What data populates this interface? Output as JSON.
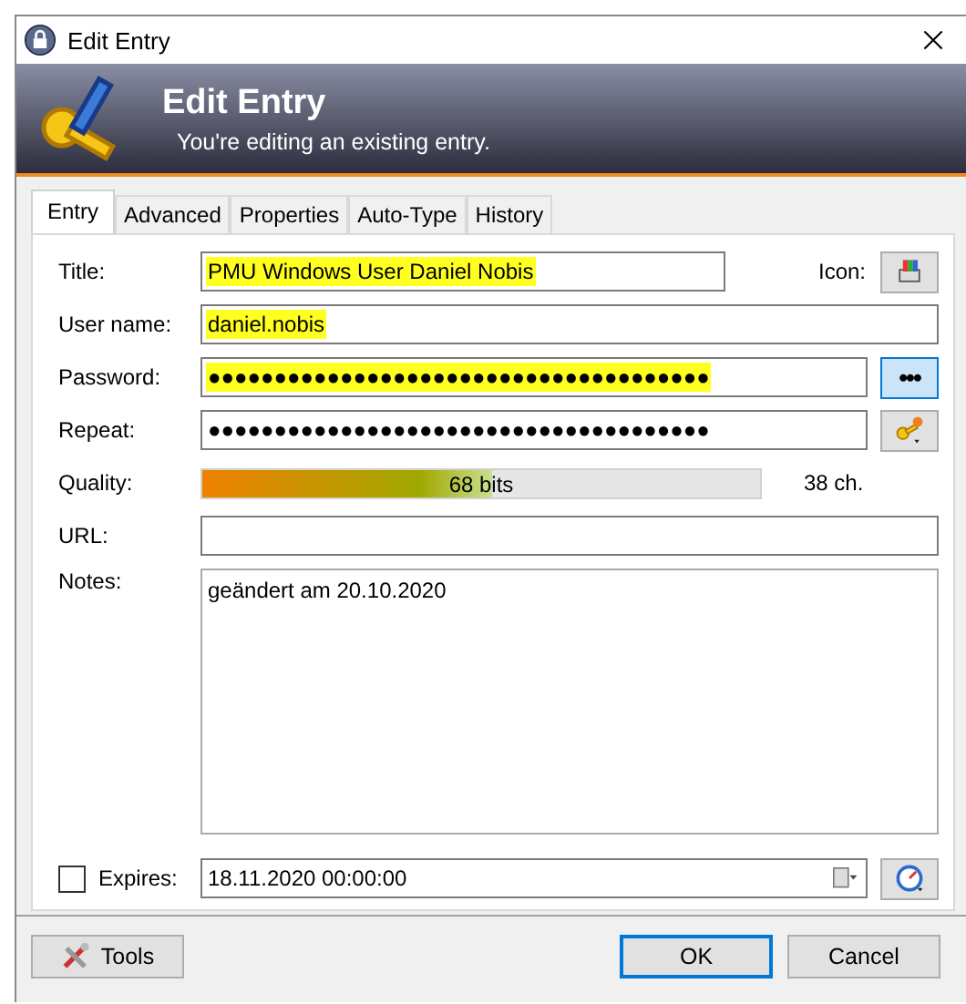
{
  "window": {
    "title": "Edit Entry"
  },
  "banner": {
    "title": "Edit Entry",
    "subtitle": "You're editing an existing entry."
  },
  "tabs": [
    {
      "label": "Entry",
      "selected": true
    },
    {
      "label": "Advanced",
      "selected": false
    },
    {
      "label": "Properties",
      "selected": false
    },
    {
      "label": "Auto-Type",
      "selected": false
    },
    {
      "label": "History",
      "selected": false
    }
  ],
  "fields": [
    {
      "kind": "title",
      "label": "Title:",
      "value": "PMU Windows User Daniel Nobis",
      "highlighted": true,
      "side_label": "Icon:"
    },
    {
      "kind": "text",
      "label": "User name:",
      "value": "daniel.nobis",
      "highlighted": true
    },
    {
      "kind": "password",
      "label": "Password:",
      "value": "●●●●●●●●●●●●●●●●●●●●●●●●●●●●●●●●●●●●●●",
      "highlighted": true,
      "button": "•••"
    },
    {
      "kind": "repeat",
      "label": "Repeat:",
      "value": "●●●●●●●●●●●●●●●●●●●●●●●●●●●●●●●●●●●●●●",
      "highlighted": false
    },
    {
      "kind": "quality",
      "label": "Quality:",
      "level": 0.52,
      "reading": "68 bits",
      "count": "38 ch."
    },
    {
      "kind": "text",
      "label": "URL:"
    },
    {
      "kind": "notes",
      "label": "Notes:",
      "value": "geändert am 20.10.2020",
      "highlighted": false
    }
  ],
  "expires": {
    "label": "Expires:",
    "checked": false,
    "value": "18.11.2020 00:00:00"
  },
  "buttons": {
    "tools": "Tools",
    "ok": "OK",
    "cancel": "Cancel"
  }
}
